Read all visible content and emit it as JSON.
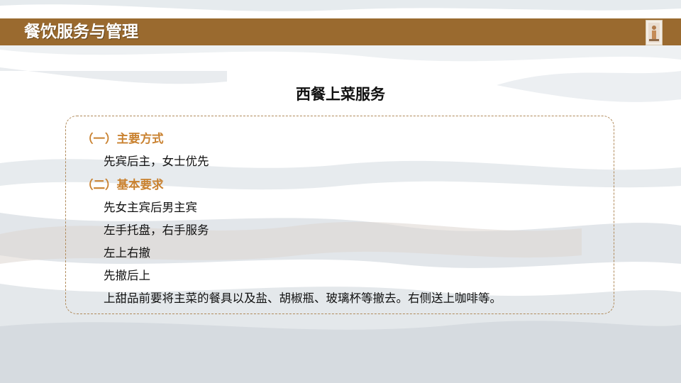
{
  "header": {
    "title": "餐饮服务与管理"
  },
  "slide": {
    "title": "西餐上菜服务",
    "sections": [
      {
        "heading": "（一）主要方式",
        "items": [
          "先宾后主，女士优先"
        ]
      },
      {
        "heading": "（二）基本要求",
        "items": [
          "先女主宾后男主宾",
          "左手托盘，右手服务",
          "左上右撤",
          "先撤后上",
          "上甜品前要将主菜的餐具以及盐、胡椒瓶、玻璃杯等撤去。右侧送上咖啡等。"
        ]
      }
    ]
  },
  "colors": {
    "header_bar": "#9a6a2f",
    "heading_text": "#c9812f",
    "box_border": "#b08a5a"
  }
}
